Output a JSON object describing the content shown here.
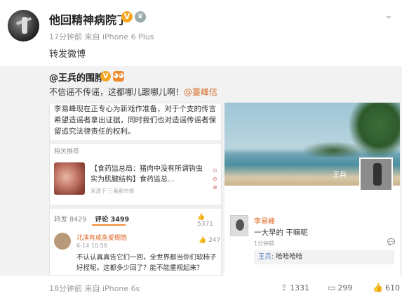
{
  "post": {
    "username": "他回精神病院了",
    "verified_badge": "V",
    "member_badge": "♛",
    "meta": "17分钟前 来自 iPhone 6 Plus",
    "text": "转发微博"
  },
  "repost": {
    "author": "@王兵的围脖",
    "text": "不信谣不传谣，这都哪儿跟哪儿啊！",
    "mention": "@薹峰信"
  },
  "left_image": {
    "top_text": "李易峰现在正专心为新戏作准备，对于个支的传言希望造谣者拿出证据，同时我们也对造谣传谣者保留追究法律责任的权利。",
    "related_label": "相关推荐",
    "news_text": "【食药监总局：猪肉中没有所谓钩虫 实为肌腱结构】食药监总...",
    "news_meta": "来源于  三番都市报",
    "news_icons": "⊙ ⊖ ⊕",
    "forward_label": "转发",
    "forward_count": "8429",
    "comment_label": "评论",
    "comment_count": "3499",
    "like_count": "5371",
    "commenter_name": "北演有咸鱼爱糊箔",
    "comment_time": "6-14 10:59",
    "comment_like": "247",
    "comment_text": "不认认真真告它们一回，全世界都当你们软柿子好捏呢。这都多少回了？能不能重视起来？"
  },
  "right_image": {
    "watermark": "王兵",
    "poster_name": "李易峰",
    "poster_text": "一大早的 干嘛呢",
    "poster_time": "1分钟前",
    "comment_icon": "💬",
    "reply_who": "王兵:",
    "reply_text": " 哈哈哈哈"
  },
  "footer": {
    "time": "18分钟前 来自 iPhone 6s",
    "repost_count": "1331",
    "comment_count": "299",
    "like_count": "610"
  }
}
